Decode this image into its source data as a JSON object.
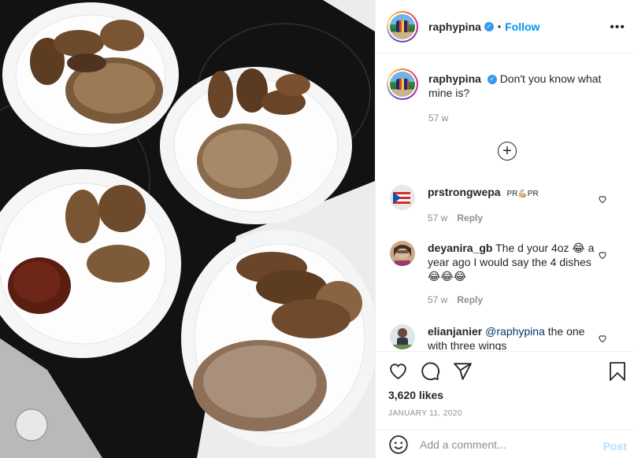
{
  "header": {
    "username": "raphypina",
    "separator": "•",
    "follow_label": "Follow",
    "more_label": "•••"
  },
  "caption": {
    "username": "raphypina",
    "text": "Don't you know what mine is?",
    "time": "57 w"
  },
  "comments": [
    {
      "username": "prstrongwepa",
      "text": "PR💪🏼PR",
      "time": "57 w",
      "reply": "Reply"
    },
    {
      "username": "deyanira_gb",
      "text": "The d your 4oz 😂 a year ago I would say the 4 dishes 😂😂😂",
      "time": "57 w",
      "reply": "Reply"
    },
    {
      "username": "elianjanier",
      "mention": "@raphypina",
      "text": " the one with three wings"
    }
  ],
  "likes": "3,620 likes",
  "date": "JANUARY 11, 2020",
  "add_comment": {
    "placeholder": "Add a comment...",
    "post_label": "Post"
  },
  "colors": {
    "accent": "#0095f6",
    "verified": "#3897f0",
    "muted": "#8e8e8e"
  },
  "icons": [
    "verified-icon",
    "more-options-icon",
    "load-more-icon",
    "heart-icon",
    "comment-icon",
    "share-icon",
    "bookmark-icon",
    "emoji-icon"
  ],
  "photo": {
    "description_icon": "food-photo"
  }
}
